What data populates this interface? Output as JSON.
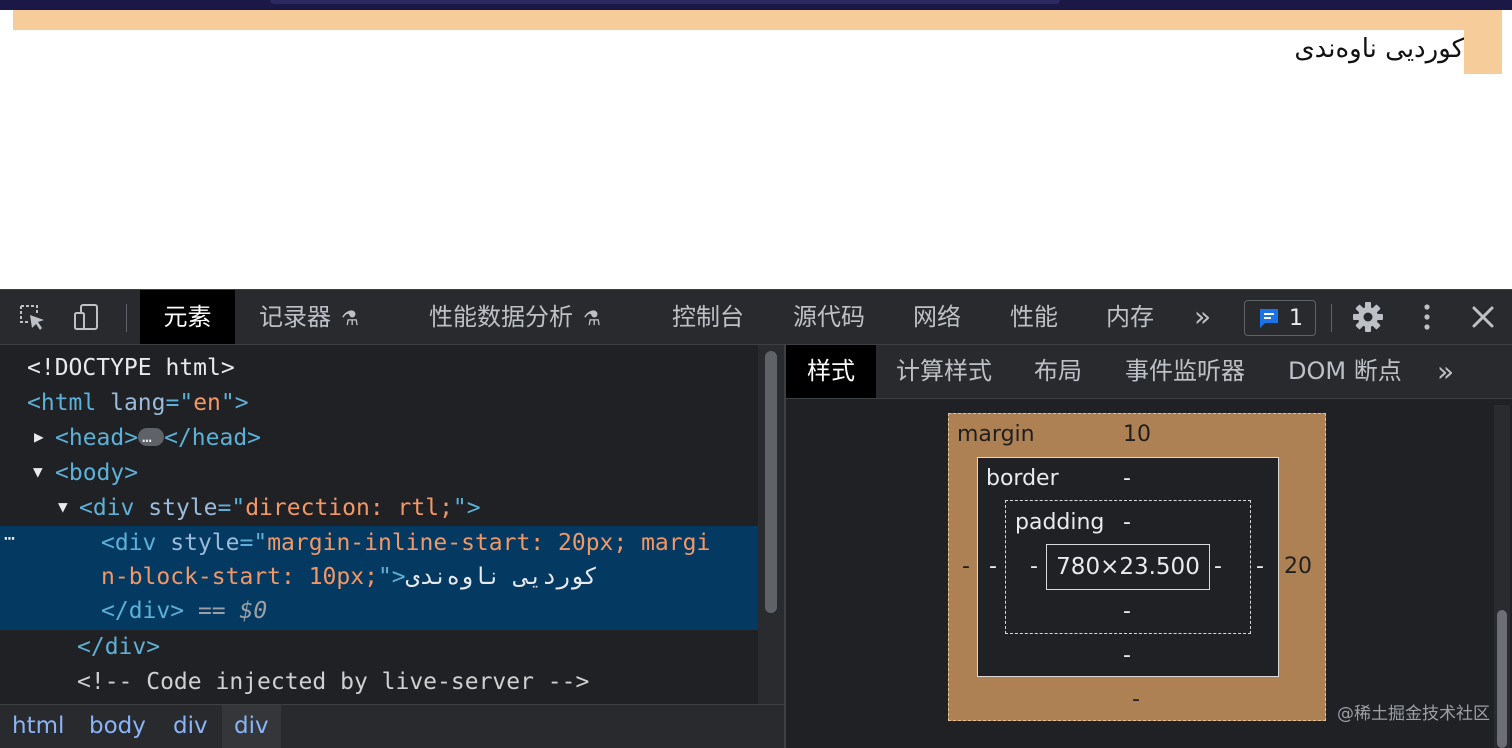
{
  "page": {
    "text": "کوردیی ناوەندی"
  },
  "toolbar": {
    "tabs": [
      "元素",
      "记录器",
      "性能数据分析",
      "控制台",
      "源代码",
      "网络",
      "性能",
      "内存"
    ],
    "more": "»",
    "issues_count": "1"
  },
  "elements": {
    "line1": "<!DOCTYPE html>",
    "html_open": "<html",
    "html_attr": "lang",
    "html_eq": "=\"",
    "html_val": "en",
    "html_close": "\">",
    "head_open": "<head>",
    "head_close": "</head>",
    "body_open": "<body>",
    "div_open": "<div",
    "div_attr": "style",
    "div_eq": "=\"",
    "div_val": "direction: rtl;",
    "div_close": "\">",
    "sel_open": "<div",
    "sel_attr": "style",
    "sel_eq": "=\"",
    "sel_val1": "margin-inline-start: 20px; margi",
    "sel_val2": "n-block-start: 10px;",
    "sel_close": "\">",
    "sel_text": "کوردیی ناوەندی",
    "sel_end": "</div>",
    "sel_eqsign": "==",
    "sel_dollar": "$0",
    "div_end": "</div>",
    "comment": "<!-- Code injected by live-server -->",
    "row_dots": "⋯"
  },
  "breadcrumb": [
    "html",
    "body",
    "div",
    "div"
  ],
  "side_tabs": [
    "样式",
    "计算样式",
    "布局",
    "事件监听器",
    "DOM 断点"
  ],
  "side_more": "»",
  "boxmodel": {
    "margin_label": "margin",
    "margin_top": "10",
    "margin_right": "20",
    "margin_bottom": "-",
    "margin_left": "-",
    "border_label": "border",
    "border_top": "-",
    "border_right": "-",
    "border_bottom": "-",
    "border_left": "-",
    "padding_label": "padding",
    "padding_top": "-",
    "padding_right": "-",
    "padding_bottom": "-",
    "padding_left": "-",
    "content": "780×23.500"
  },
  "watermark": "@稀土掘金技术社区"
}
